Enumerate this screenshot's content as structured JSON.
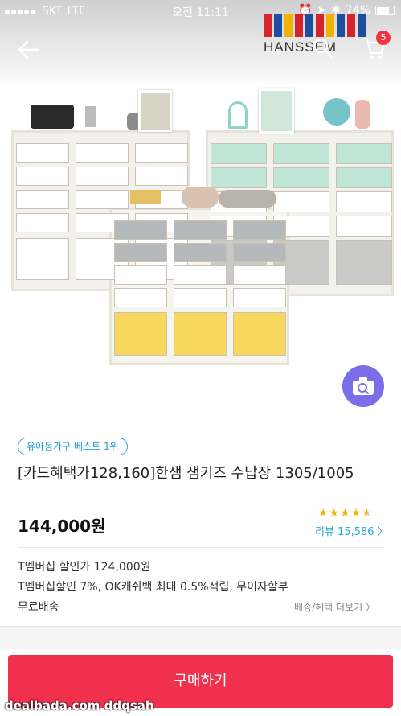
{
  "status_bar": {
    "carrier": "SKT",
    "network": "LTE",
    "time": "오전 11:11",
    "battery": "74%"
  },
  "header": {
    "brand_name": "HANSSEM",
    "cart_count": "5",
    "brand_colors": [
      "#d6232c",
      "#1f4da0",
      "#f2b300",
      "#d6232c",
      "#1f4da0",
      "#d6232c",
      "#f2b300",
      "#1f4da0",
      "#d6232c",
      "#1f4da0"
    ]
  },
  "product": {
    "rank_badge": "유아동가구 베스트 1위",
    "title": "[카드혜택가128,160]한샘 샘키즈 수납장 1305/1005",
    "price": "144,000원",
    "rating": 4.5,
    "stars": "★★★★★",
    "review_label": "리뷰 15,586 〉",
    "member_price": "T멤버십 할인가 124,000원",
    "benefits": "T멤버십할인 7%, OK캐쉬백 최대 0.5%적립, 무이자할부",
    "shipping": "무료배송",
    "more_label": "배송/혜택 더보기 〉"
  },
  "actions": {
    "buy_label": "구매하기"
  },
  "watermark": "dealbada.com ddqsah",
  "colors": {
    "accent": "#f0304c",
    "link": "#2aa7d8",
    "camera_button": "#7b6ee8",
    "star": "#f5b400"
  }
}
